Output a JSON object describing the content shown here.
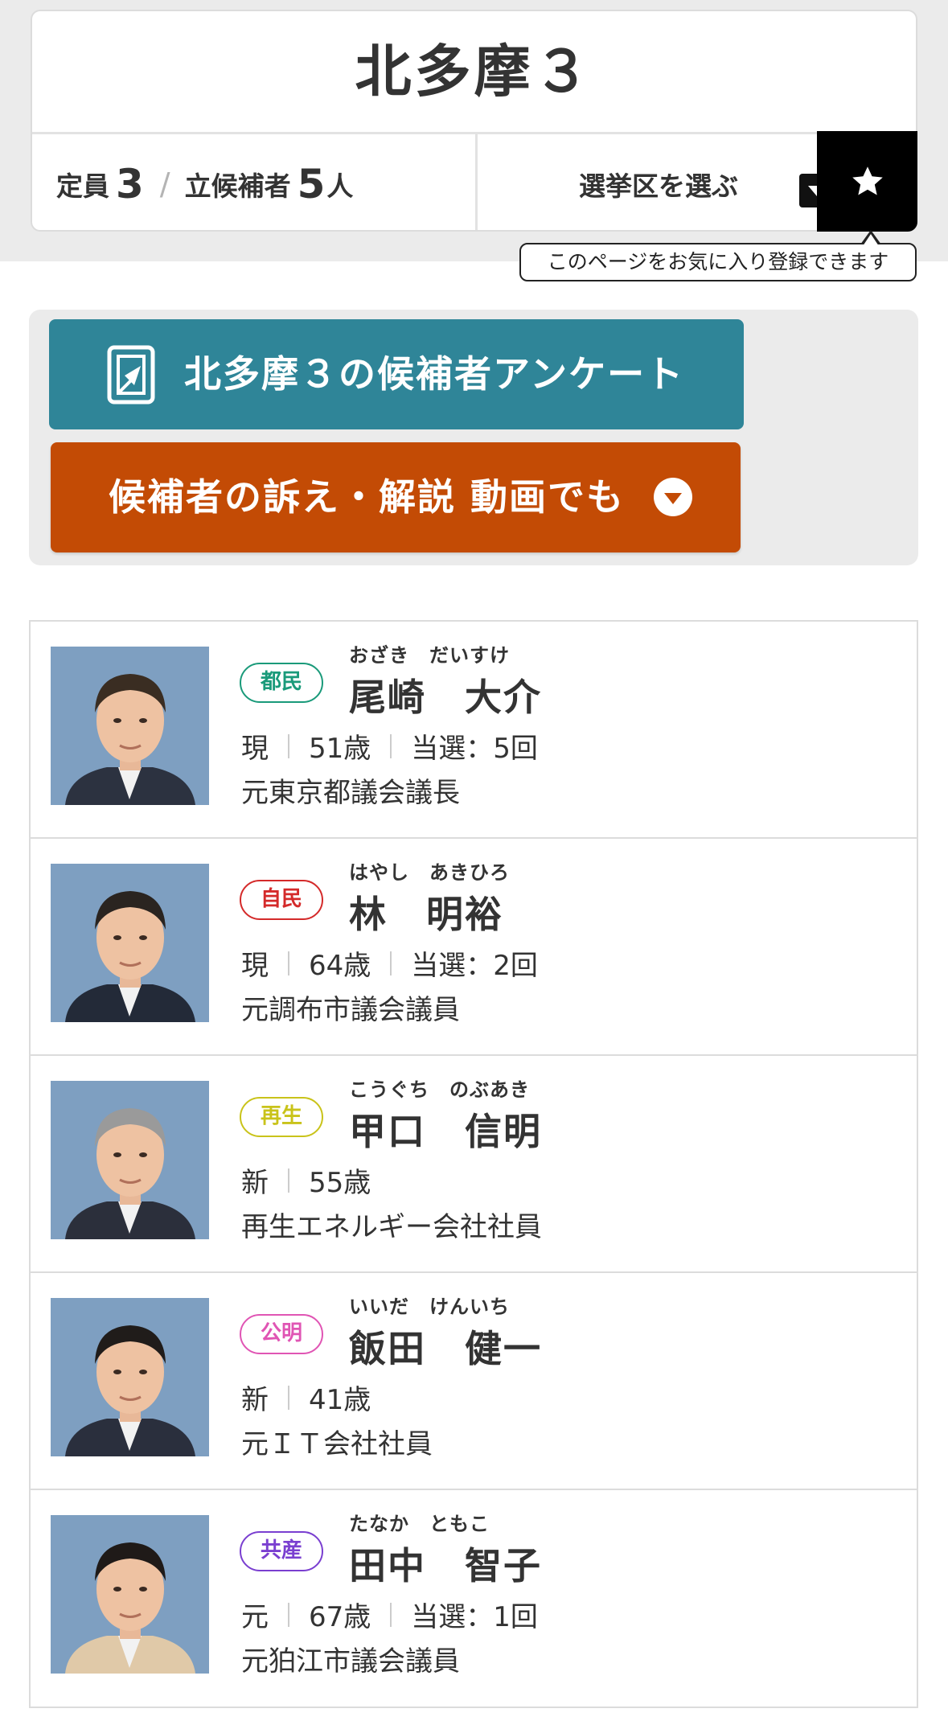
{
  "district": {
    "title": "北多摩３",
    "seats_label": "定員",
    "seats_value": "3",
    "separator": "/",
    "candidates_label": "立候補者",
    "candidates_value": "5",
    "candidates_unit": "人",
    "select_label": "選挙区を選ぶ",
    "favorite_tooltip": "このページをお気に入り登録できます"
  },
  "actions": {
    "survey_label": "北多摩３の候補者アンケート",
    "video_label": "候補者の訴え・解説 動画でも"
  },
  "candidates": [
    {
      "party": "都民",
      "party_color": "#1a9a7a",
      "furigana": "おざき　だいすけ",
      "name": "尾崎　大介",
      "status": "現",
      "age": "51歳",
      "wins": "当選：5回",
      "career": "元東京都議会議長",
      "suit_color": "#2c3240",
      "hair_color": "#3a2d22"
    },
    {
      "party": "自民",
      "party_color": "#d42a2a",
      "furigana": "はやし　あきひろ",
      "name": "林　明裕",
      "status": "現",
      "age": "64歳",
      "wins": "当選：2回",
      "career": "元調布市議会議員",
      "suit_color": "#232a38",
      "hair_color": "#2a2420"
    },
    {
      "party": "再生",
      "party_color": "#c9c31a",
      "furigana": "こうぐち　のぶあき",
      "name": "甲口　信明",
      "status": "新",
      "age": "55歳",
      "wins": "",
      "career": "再生エネルギー会社社員",
      "suit_color": "#2b2f3b",
      "hair_color": "#9a9a9a"
    },
    {
      "party": "公明",
      "party_color": "#e055b4",
      "furigana": "いいだ　けんいち",
      "name": "飯田　健一",
      "status": "新",
      "age": "41歳",
      "wins": "",
      "career": "元ＩＴ会社社員",
      "suit_color": "#2a2f3d",
      "hair_color": "#201c1a"
    },
    {
      "party": "共産",
      "party_color": "#7a3fd0",
      "furigana": "たなか　ともこ",
      "name": "田中　智子",
      "status": "元",
      "age": "67歳",
      "wins": "当選：1回",
      "career": "元狛江市議会議員",
      "suit_color": "#e0c9a8",
      "hair_color": "#1f1a18"
    }
  ],
  "colors": {
    "survey_button": "#2f8598",
    "video_button": "#c34b05",
    "photo_background": "#7e9fc1"
  },
  "icons": {
    "favorite": "star-icon",
    "select": "triangle-down-icon",
    "survey": "survey-document-icon",
    "video": "chevron-down-circle-icon"
  }
}
